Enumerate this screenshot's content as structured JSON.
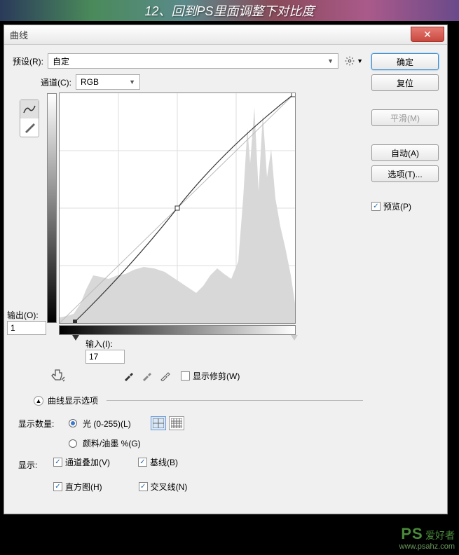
{
  "caption": "12、回到PS里面调整下对比度",
  "dialog": {
    "title": "曲线",
    "preset_label": "预设(R):",
    "preset_value": "自定",
    "channel_label": "通道(C):",
    "channel_value": "RGB",
    "output_label": "输出(O):",
    "output_value": "1",
    "input_label": "输入(I):",
    "input_value": "17",
    "show_clip": "显示修剪(W)",
    "expander": "曲线显示选项",
    "amount_label": "显示数量:",
    "amount_light": "光 (0-255)(L)",
    "amount_pigment": "颜料/油墨 %(G)",
    "show_label": "显示:",
    "ch_overlay": "通道叠加(V)",
    "baseline": "基线(B)",
    "histogram": "直方图(H)",
    "intersect": "交叉线(N)"
  },
  "buttons": {
    "ok": "确定",
    "cancel": "复位",
    "smooth": "平滑(M)",
    "auto": "自动(A)",
    "options": "选项(T)...",
    "preview": "预览(P)"
  },
  "watermark": {
    "logo": "PS",
    "cn": "爱好者",
    "url": "www.psahz.com"
  }
}
